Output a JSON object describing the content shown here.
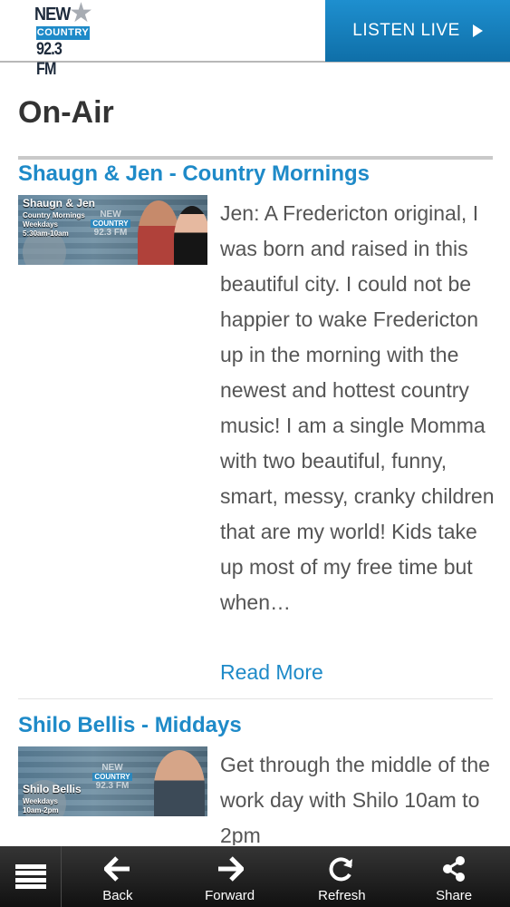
{
  "header": {
    "logo_line1": "NEW",
    "logo_line2": "COUNTRY",
    "logo_line3": "92.3 FM",
    "listen_label": "LISTEN LIVE"
  },
  "page_title": "On-Air",
  "shows": [
    {
      "title": "Shaugn & Jen - Country Mornings",
      "image_name": "Shaugn & Jen",
      "image_show": "Country Mornings",
      "image_days": "Weekdays",
      "image_time": "5:30am-10am",
      "description": "Jen: A Fredericton original, I was born and raised in this beautiful city.  I could not be happier to wake Fredericton up in the morning with the newest and hottest country music! I am a single Momma with two beautiful, funny, smart, messy, cranky children that are my world! Kids take up most of my free time but when…",
      "read_more": "Read More"
    },
    {
      "title": "Shilo Bellis - Middays",
      "image_name": "Shilo Bellis",
      "image_days": "Weekdays",
      "image_time": "10am-2pm",
      "description": "Get through the middle of the work day with Shilo 10am to 2pm"
    }
  ],
  "toolbar": {
    "back": "Back",
    "forward": "Forward",
    "refresh": "Refresh",
    "share": "Share"
  },
  "colors": {
    "accent": "#1e8ac8",
    "toolbar_bg": "#1a1a1a"
  }
}
